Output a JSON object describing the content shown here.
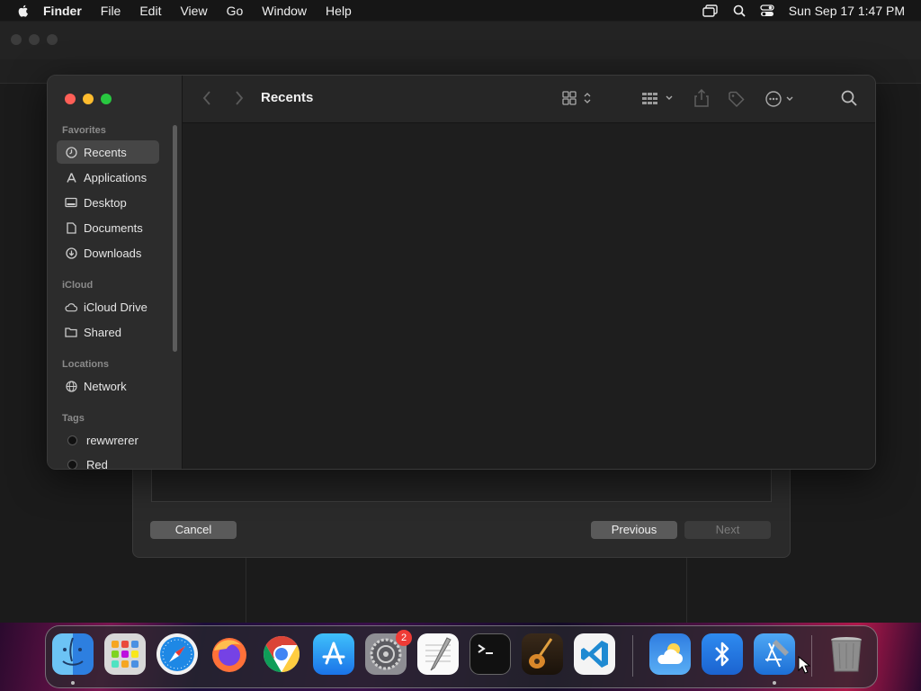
{
  "menubar": {
    "app_name": "Finder",
    "items": [
      "File",
      "Edit",
      "View",
      "Go",
      "Window",
      "Help"
    ],
    "clock": "Sun Sep 17  1:47 PM"
  },
  "finder": {
    "title": "Recents",
    "sidebar": {
      "favorites_header": "Favorites",
      "favorites": [
        {
          "label": "Recents",
          "icon": "clock-icon",
          "selected": true
        },
        {
          "label": "Applications",
          "icon": "applications-icon"
        },
        {
          "label": "Desktop",
          "icon": "desktop-icon"
        },
        {
          "label": "Documents",
          "icon": "document-icon"
        },
        {
          "label": "Downloads",
          "icon": "download-icon"
        }
      ],
      "icloud_header": "iCloud",
      "icloud": [
        {
          "label": "iCloud Drive",
          "icon": "cloud-icon"
        },
        {
          "label": "Shared",
          "icon": "shared-folder-icon"
        }
      ],
      "locations_header": "Locations",
      "locations": [
        {
          "label": "Network",
          "icon": "globe-icon"
        }
      ],
      "tags_header": "Tags",
      "tags": [
        {
          "label": "rewwrerer",
          "color": "#111111"
        },
        {
          "label": "Red",
          "color": "#111111"
        }
      ]
    }
  },
  "sheet": {
    "cancel_label": "Cancel",
    "previous_label": "Previous",
    "next_label": "Next"
  },
  "dock": {
    "apps": [
      "Finder",
      "Launchpad",
      "Safari",
      "Firefox",
      "Chrome",
      "App Store",
      "System Settings",
      "TextEdit",
      "Terminal",
      "GarageBand",
      "Visual Studio Code",
      "Weather",
      "Bluetooth",
      "Xcode",
      "Trash"
    ],
    "settings_badge": "2"
  },
  "colors": {
    "close": "#ff5f57",
    "minimize": "#febc2e",
    "zoom": "#28c840"
  }
}
